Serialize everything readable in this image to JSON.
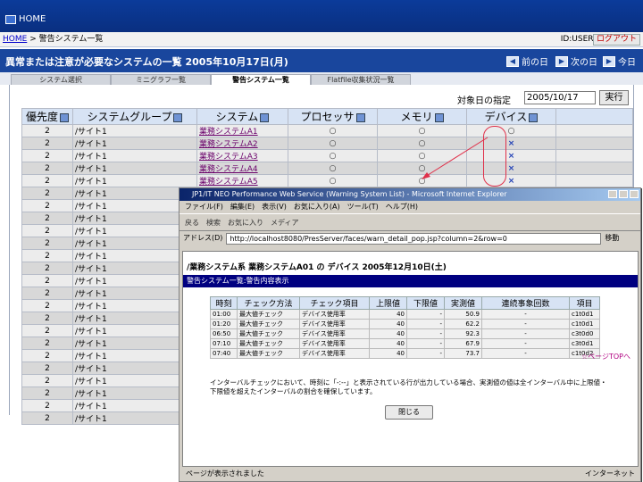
{
  "header": {
    "home_label": "HOME"
  },
  "breadcrumb": {
    "home": "HOME",
    "current": "警告システム一覧"
  },
  "user": {
    "id_label": "ID:USER01",
    "logout": "ログアウト"
  },
  "title": {
    "text": "異常または注意が必要なシステムの一覧 2005年10月17日(月)",
    "prev_day": "前の日",
    "next_day": "次の日",
    "today": "今日"
  },
  "tabs": [
    "システム選択",
    "ミニグラフ一覧",
    "警告システム一覧",
    "Flatfile収集状況一覧"
  ],
  "date_filter": {
    "label": "対象日の指定",
    "value": "2005/10/17",
    "button": "実行"
  },
  "table": {
    "headers": [
      "優先度",
      "システムグループ",
      "システム",
      "プロセッサ",
      "メモリ",
      "デバイス"
    ],
    "rows": [
      {
        "priority": "2",
        "group": "/サイト1",
        "system": "業務システムA1",
        "cpu": "○",
        "mem": "○",
        "dev": "○"
      },
      {
        "priority": "2",
        "group": "/サイト1",
        "system": "業務システムA2",
        "cpu": "○",
        "mem": "○",
        "dev": "×"
      },
      {
        "priority": "2",
        "group": "/サイト1",
        "system": "業務システムA3",
        "cpu": "○",
        "mem": "○",
        "dev": "×"
      },
      {
        "priority": "2",
        "group": "/サイト1",
        "system": "業務システムA4",
        "cpu": "○",
        "mem": "○",
        "dev": "×"
      },
      {
        "priority": "2",
        "group": "/サイト1",
        "system": "業務システムA5",
        "cpu": "○",
        "mem": "○",
        "dev": "×"
      },
      {
        "priority": "2",
        "group": "/サイト1",
        "system": "",
        "cpu": "",
        "mem": "",
        "dev": ""
      },
      {
        "priority": "2",
        "group": "/サイト1",
        "system": "",
        "cpu": "",
        "mem": "",
        "dev": ""
      },
      {
        "priority": "2",
        "group": "/サイト1",
        "system": "",
        "cpu": "",
        "mem": "",
        "dev": ""
      },
      {
        "priority": "2",
        "group": "/サイト1",
        "system": "",
        "cpu": "",
        "mem": "",
        "dev": ""
      },
      {
        "priority": "2",
        "group": "/サイト1",
        "system": "",
        "cpu": "",
        "mem": "",
        "dev": ""
      },
      {
        "priority": "2",
        "group": "/サイト1",
        "system": "",
        "cpu": "",
        "mem": "",
        "dev": ""
      },
      {
        "priority": "2",
        "group": "/サイト1",
        "system": "",
        "cpu": "",
        "mem": "",
        "dev": ""
      },
      {
        "priority": "2",
        "group": "/サイト1",
        "system": "",
        "cpu": "",
        "mem": "",
        "dev": ""
      },
      {
        "priority": "2",
        "group": "/サイト1",
        "system": "",
        "cpu": "",
        "mem": "",
        "dev": ""
      },
      {
        "priority": "2",
        "group": "/サイト1",
        "system": "",
        "cpu": "",
        "mem": "",
        "dev": ""
      },
      {
        "priority": "2",
        "group": "/サイト1",
        "system": "",
        "cpu": "",
        "mem": "",
        "dev": ""
      },
      {
        "priority": "2",
        "group": "/サイト1",
        "system": "",
        "cpu": "",
        "mem": "",
        "dev": ""
      },
      {
        "priority": "2",
        "group": "/サイト1",
        "system": "",
        "cpu": "",
        "mem": "",
        "dev": ""
      },
      {
        "priority": "2",
        "group": "/サイト1",
        "system": "",
        "cpu": "",
        "mem": "",
        "dev": ""
      },
      {
        "priority": "2",
        "group": "/サイト1",
        "system": "",
        "cpu": "",
        "mem": "",
        "dev": ""
      },
      {
        "priority": "2",
        "group": "/サイト1",
        "system": "",
        "cpu": "",
        "mem": "",
        "dev": ""
      },
      {
        "priority": "2",
        "group": "/サイト1",
        "system": "",
        "cpu": "",
        "mem": "",
        "dev": ""
      },
      {
        "priority": "2",
        "group": "/サイト1",
        "system": "",
        "cpu": "",
        "mem": "",
        "dev": ""
      },
      {
        "priority": "2",
        "group": "/サイト1",
        "system": "",
        "cpu": "",
        "mem": "",
        "dev": ""
      }
    ]
  },
  "popup": {
    "window_title": "JP1/IT NEO Performance Web Service (Warning System List) - Microsoft Internet Explorer",
    "menu": [
      "ファイル(F)",
      "編集(E)",
      "表示(V)",
      "お気に入り(A)",
      "ツール(T)",
      "ヘルプ(H)"
    ],
    "toolbar": [
      "戻る",
      "検索",
      "お気に入り",
      "メディア"
    ],
    "address_label": "アドレス(D)",
    "address": "http://localhost8080/PresServer/faces/warn_detail_pop.jsp?column=2&row=0",
    "go": "移動",
    "heading": "/業務システム系 業務システムA01 の デバイス 2005年12月10日(土)",
    "bar": "警告システム一覧:警告内容表示",
    "headers": [
      "時刻",
      "チェック方法",
      "チェック項目",
      "上限値",
      "下限値",
      "実測値",
      "連続事象回数",
      "項目"
    ],
    "rows": [
      [
        "01:00",
        "最大値チェック",
        "デバイス使用率",
        "40",
        "-",
        "50.9",
        "-",
        "c1t0d1"
      ],
      [
        "01:20",
        "最大値チェック",
        "デバイス使用率",
        "40",
        "-",
        "62.2",
        "-",
        "c1t0d1"
      ],
      [
        "06:50",
        "最大値チェック",
        "デバイス使用率",
        "40",
        "-",
        "92.3",
        "-",
        "c3t0d0"
      ],
      [
        "07:10",
        "最大値チェック",
        "デバイス使用率",
        "40",
        "-",
        "67.9",
        "-",
        "c3t0d1"
      ],
      [
        "07:40",
        "最大値チェック",
        "デバイス使用率",
        "40",
        "-",
        "73.7",
        "-",
        "c1t0d2"
      ]
    ],
    "top_link": "ページTOPへ",
    "note": "インターバルチェックにおいて、時刻に「-:--」と表示されている行が出力している場合、実測値の値は全インターバル中に上限値・下限値を超えたインターバルの割合を確保しています。",
    "close": "閉じる",
    "status_left": "ページが表示されました",
    "status_right": "インターネット"
  }
}
